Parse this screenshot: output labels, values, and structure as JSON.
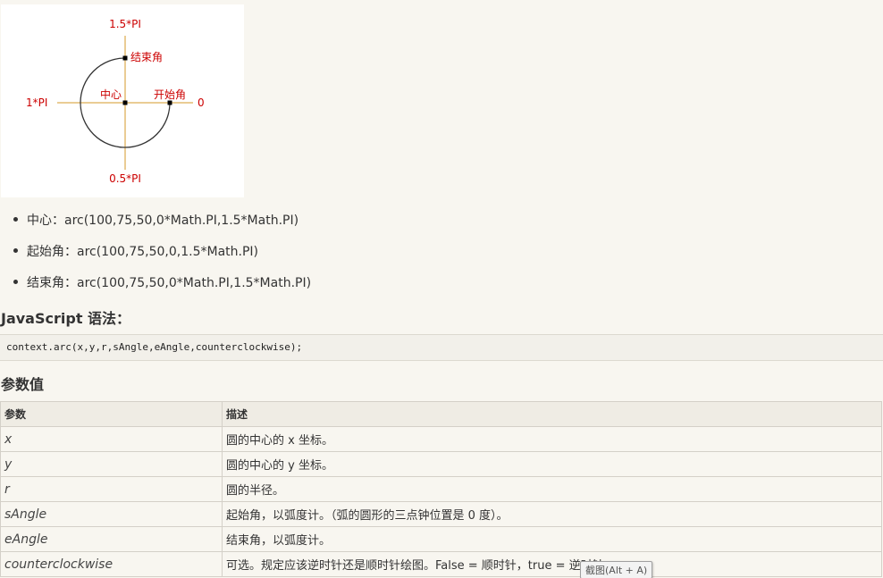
{
  "figure": {
    "label_top": "1.5*PI",
    "label_left": "1*PI",
    "label_right": "0",
    "label_bottom": "0.5*PI",
    "label_end": "结束角",
    "label_start": "开始角",
    "label_center": "中心",
    "colors": {
      "axis": "#d49a2a",
      "label": "#cc0000",
      "arc": "#333333"
    }
  },
  "bullets": [
    {
      "text": "中心：arc(100,75,50,0*Math.PI,1.5*Math.PI)"
    },
    {
      "text": "起始角：arc(100,75,50,0,1.5*Math.PI)"
    },
    {
      "text": "结束角：arc(100,75,50,0*Math.PI,1.5*Math.PI)"
    }
  ],
  "syntax": {
    "heading": "JavaScript 语法：",
    "code": "context.arc(x,y,r,sAngle,eAngle,counterclockwise);"
  },
  "params": {
    "heading": "参数值",
    "headers": [
      "参数",
      "描述"
    ],
    "rows": [
      {
        "name": "x",
        "desc": "圆的中心的 x 坐标。"
      },
      {
        "name": "y",
        "desc": "圆的中心的 y 坐标。"
      },
      {
        "name": "r",
        "desc": "圆的半径。"
      },
      {
        "name": "sAngle",
        "desc": "起始角，以弧度计。（弧的圆形的三点钟位置是 0 度）。"
      },
      {
        "name": "eAngle",
        "desc": "结束角，以弧度计。"
      },
      {
        "name": "counterclockwise",
        "desc": "可选。规定应该逆时针还是顺时针绘图。False = 顺时针，true = 逆时针。"
      }
    ]
  },
  "tooltip": {
    "text": "截图(Alt + A)"
  }
}
